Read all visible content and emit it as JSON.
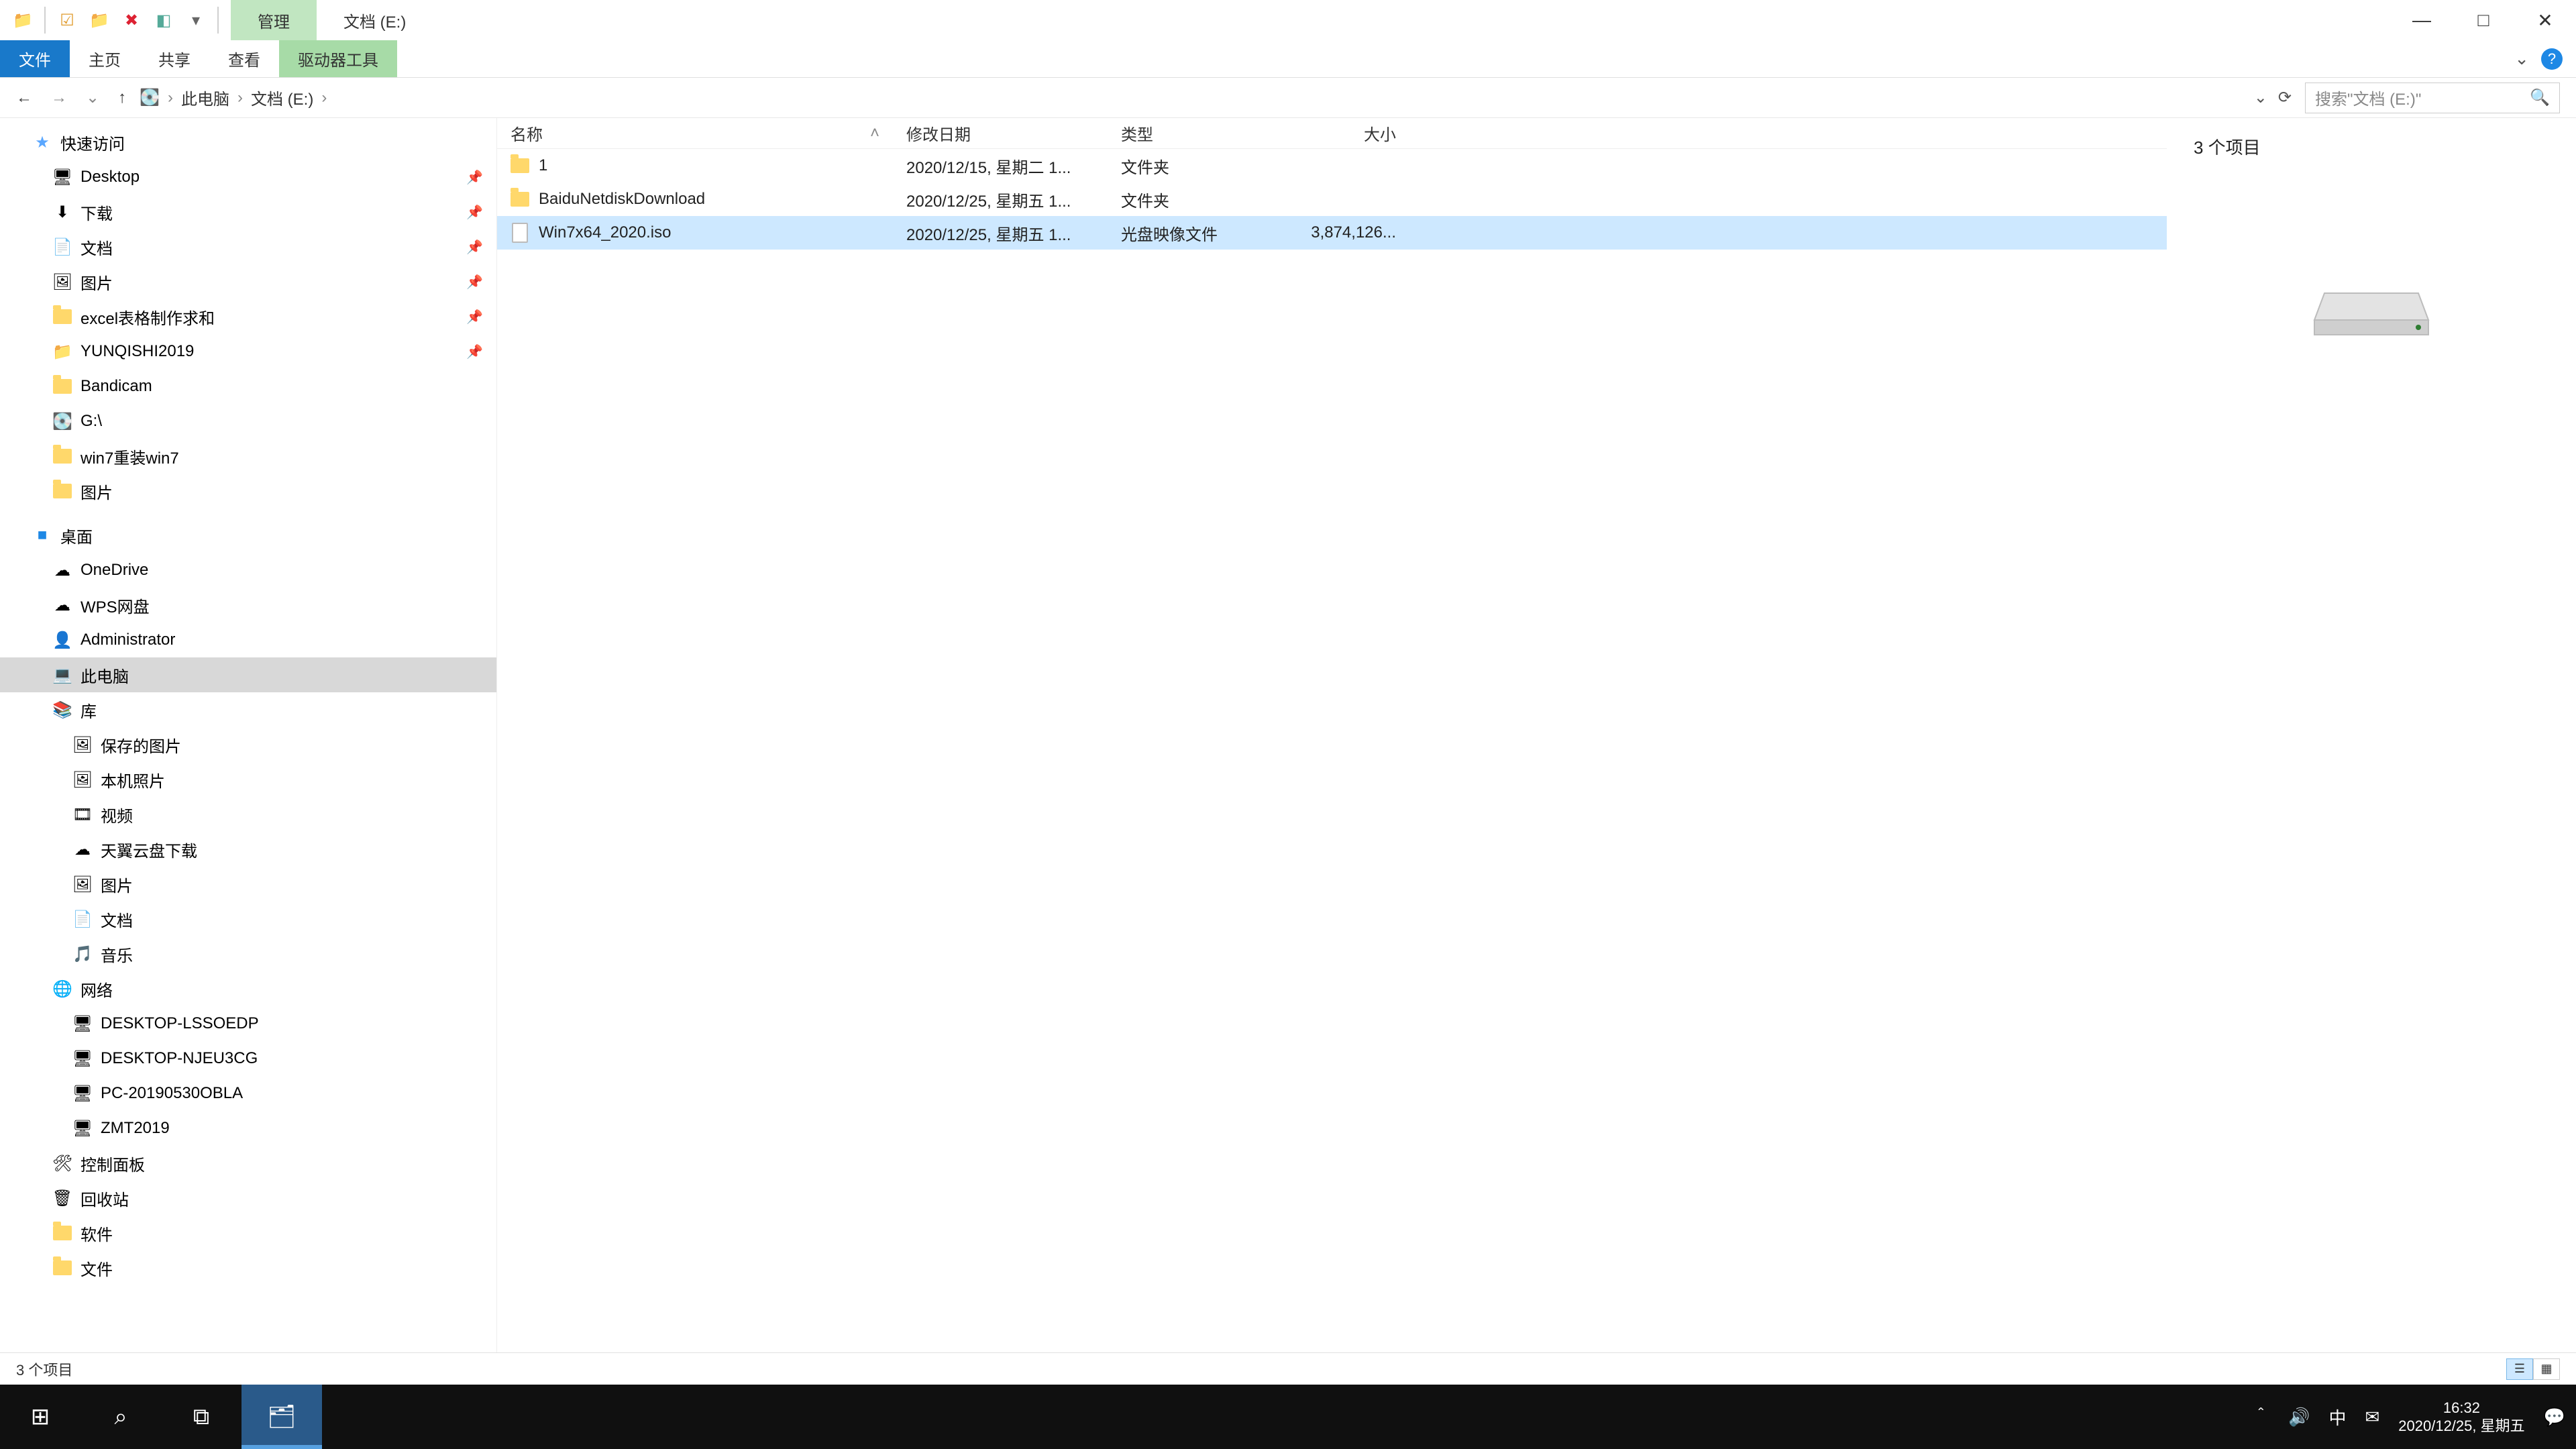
{
  "title": {
    "contextual_tab": "管理",
    "window_title": "文档 (E:)"
  },
  "window_controls": {
    "min": "—",
    "max": "□",
    "close": "✕"
  },
  "ribbon": {
    "file": "文件",
    "home": "主页",
    "share": "共享",
    "view": "查看",
    "drive_tools": "驱动器工具",
    "collapse": "⌄",
    "help": "?"
  },
  "nav": {
    "back": "←",
    "forward": "→",
    "recent": "⌄",
    "up": "↑",
    "breadcrumb": [
      "此电脑",
      "文档 (E:)"
    ],
    "bc_dropdown": "⌄",
    "refresh": "⟳",
    "search_placeholder": "搜索\"文档 (E:)\"",
    "search_icon": "🔍"
  },
  "tree": {
    "groups": [
      {
        "label": "快速访问",
        "icon": "star",
        "depth": 0,
        "children": [
          {
            "label": "Desktop",
            "icon": "desktop",
            "pinned": true
          },
          {
            "label": "下载",
            "icon": "download",
            "pinned": true
          },
          {
            "label": "文档",
            "icon": "doc",
            "pinned": true
          },
          {
            "label": "图片",
            "icon": "pic",
            "pinned": true
          },
          {
            "label": "excel表格制作求和",
            "icon": "folder",
            "pinned": true
          },
          {
            "label": "YUNQISHI2019",
            "icon": "folder-blue",
            "pinned": true
          },
          {
            "label": "Bandicam",
            "icon": "folder"
          },
          {
            "label": "G:\\",
            "icon": "drive"
          },
          {
            "label": "win7重装win7",
            "icon": "folder"
          },
          {
            "label": "图片",
            "icon": "folder"
          }
        ]
      },
      {
        "label": "桌面",
        "icon": "desktop-solid",
        "depth": 0,
        "children": [
          {
            "label": "OneDrive",
            "icon": "cloud"
          },
          {
            "label": "WPS网盘",
            "icon": "cloud-blue"
          },
          {
            "label": "Administrator",
            "icon": "user"
          },
          {
            "label": "此电脑",
            "icon": "pc",
            "selected": true
          },
          {
            "label": "库",
            "icon": "library"
          },
          {
            "label": "保存的图片",
            "icon": "pic",
            "depth2": true
          },
          {
            "label": "本机照片",
            "icon": "pic",
            "depth2": true
          },
          {
            "label": "视频",
            "icon": "video",
            "depth2": true
          },
          {
            "label": "天翼云盘下载",
            "icon": "cloud",
            "depth2": true
          },
          {
            "label": "图片",
            "icon": "pic",
            "depth2": true
          },
          {
            "label": "文档",
            "icon": "doc",
            "depth2": true
          },
          {
            "label": "音乐",
            "icon": "music",
            "depth2": true
          },
          {
            "label": "网络",
            "icon": "network"
          },
          {
            "label": "DESKTOP-LSSOEDP",
            "icon": "pc-net",
            "depth2": true
          },
          {
            "label": "DESKTOP-NJEU3CG",
            "icon": "pc-net",
            "depth2": true
          },
          {
            "label": "PC-20190530OBLA",
            "icon": "pc-net",
            "depth2": true
          },
          {
            "label": "ZMT2019",
            "icon": "pc-net",
            "depth2": true
          },
          {
            "label": "控制面板",
            "icon": "cpl"
          },
          {
            "label": "回收站",
            "icon": "bin"
          },
          {
            "label": "软件",
            "icon": "folder"
          },
          {
            "label": "文件",
            "icon": "folder"
          }
        ]
      }
    ]
  },
  "columns": {
    "name": "名称",
    "date": "修改日期",
    "type": "类型",
    "size": "大小"
  },
  "files": [
    {
      "name": "1",
      "date": "2020/12/15, 星期二 1...",
      "type": "文件夹",
      "size": "",
      "icon": "folder"
    },
    {
      "name": "BaiduNetdiskDownload",
      "date": "2020/12/25, 星期五 1...",
      "type": "文件夹",
      "size": "",
      "icon": "folder"
    },
    {
      "name": "Win7x64_2020.iso",
      "date": "2020/12/25, 星期五 1...",
      "type": "光盘映像文件",
      "size": "3,874,126...",
      "icon": "file",
      "selected": true
    }
  ],
  "preview": {
    "summary": "3 个项目"
  },
  "status": {
    "text": "3 个项目"
  },
  "taskbar": {
    "buttons": [
      {
        "name": "start",
        "glyph": "⊞"
      },
      {
        "name": "search",
        "glyph": "⌕"
      },
      {
        "name": "taskview",
        "glyph": "⧉"
      },
      {
        "name": "explorer",
        "glyph": "🗂",
        "active": true
      }
    ],
    "tray": {
      "chevron": "＾",
      "volume": "🔊",
      "ime": "中",
      "mail": "✉",
      "notify": "💬",
      "time": "16:32",
      "date": "2020/12/25, 星期五"
    }
  },
  "colors": {
    "accent": "#1979ca",
    "context": "#c1e6c1",
    "select": "#cde8ff"
  }
}
